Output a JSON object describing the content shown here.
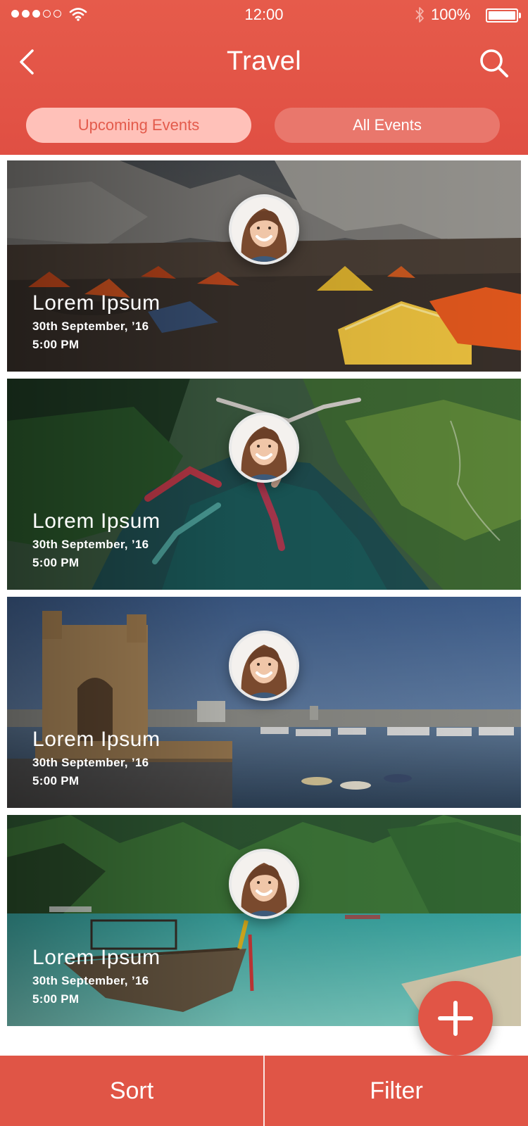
{
  "status_bar": {
    "time": "12:00",
    "battery": "100%",
    "signal_bars_filled": 3,
    "signal_bars_total": 5
  },
  "header": {
    "title": "Travel",
    "back_icon": "chevron-left-icon",
    "search_icon": "search-icon"
  },
  "tabs": [
    {
      "label": "Upcoming Events",
      "active": true
    },
    {
      "label": "All Events",
      "active": false
    }
  ],
  "events": [
    {
      "title": "Lorem Ipsum",
      "date": "30th September, ’16",
      "time": "5:00 PM",
      "scene": "mountain-camp"
    },
    {
      "title": "Lorem Ipsum",
      "date": "30th September, ’16",
      "time": "5:00 PM",
      "scene": "bungee-valley"
    },
    {
      "title": "Lorem Ipsum",
      "date": "30th September, ’16",
      "time": "5:00 PM",
      "scene": "gateway-harbour"
    },
    {
      "title": "Lorem Ipsum",
      "date": "30th September, ’16",
      "time": "5:00 PM",
      "scene": "tropical-beach"
    }
  ],
  "fab": {
    "icon": "plus-icon"
  },
  "bottom_bar": {
    "sort_label": "Sort",
    "filter_label": "Filter"
  },
  "colors": {
    "primary": "#e05546",
    "tab_active_bg": "#ffc1b9",
    "tab_inactive_bg": "#e9776c"
  }
}
